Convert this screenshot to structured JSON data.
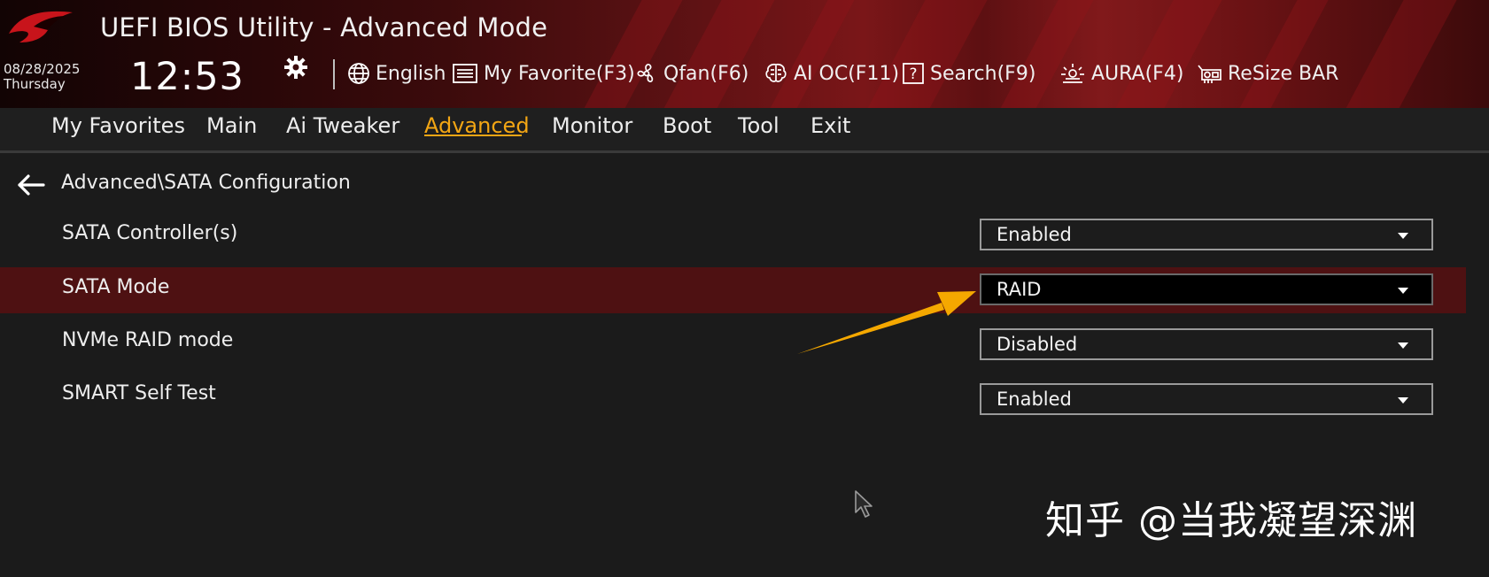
{
  "app": {
    "title": "UEFI BIOS Utility - Advanced Mode",
    "brand_logo": "rog-eye-logo"
  },
  "status": {
    "date": "08/28/2025",
    "day": "Thursday",
    "time": "12:53"
  },
  "toolbar": {
    "settings_icon": "gear-icon",
    "language": {
      "label": "English",
      "icon": "globe-icon"
    },
    "favorite": {
      "label": "My Favorite(F3)",
      "icon": "list-icon"
    },
    "qfan": {
      "label": "Qfan(F6)",
      "icon": "fan-icon"
    },
    "aioc": {
      "label": "AI OC(F11)",
      "icon": "brain-icon"
    },
    "search": {
      "label": "Search(F9)",
      "icon": "question-box-icon"
    },
    "aura": {
      "label": "AURA(F4)",
      "icon": "aura-light-icon"
    },
    "resizebar": {
      "label": "ReSize BAR",
      "icon": "gpu-card-icon"
    }
  },
  "nav": {
    "active": "Advanced",
    "tabs": [
      {
        "label": "My Favorites"
      },
      {
        "label": "Main"
      },
      {
        "label": "Ai Tweaker"
      },
      {
        "label": "Advanced"
      },
      {
        "label": "Monitor"
      },
      {
        "label": "Boot"
      },
      {
        "label": "Tool"
      },
      {
        "label": "Exit"
      }
    ]
  },
  "breadcrumb": {
    "text": "Advanced\\SATA Configuration",
    "back_icon": "back-arrow-icon"
  },
  "settings": [
    {
      "label": "SATA Controller(s)",
      "value": "Enabled",
      "selected": false
    },
    {
      "label": "SATA Mode",
      "value": "RAID",
      "selected": true
    },
    {
      "label": "NVMe RAID mode",
      "value": "Disabled",
      "selected": false
    },
    {
      "label": "SMART Self Test",
      "value": "Enabled",
      "selected": false
    }
  ],
  "annotation": {
    "icon": "annotation-arrow",
    "color": "#f5a800"
  },
  "watermark": {
    "text": "知乎 @当我凝望深渊"
  },
  "colors": {
    "accent": "#f3a614",
    "selected_row": "#4e1112",
    "header_red": "#7a1618"
  }
}
